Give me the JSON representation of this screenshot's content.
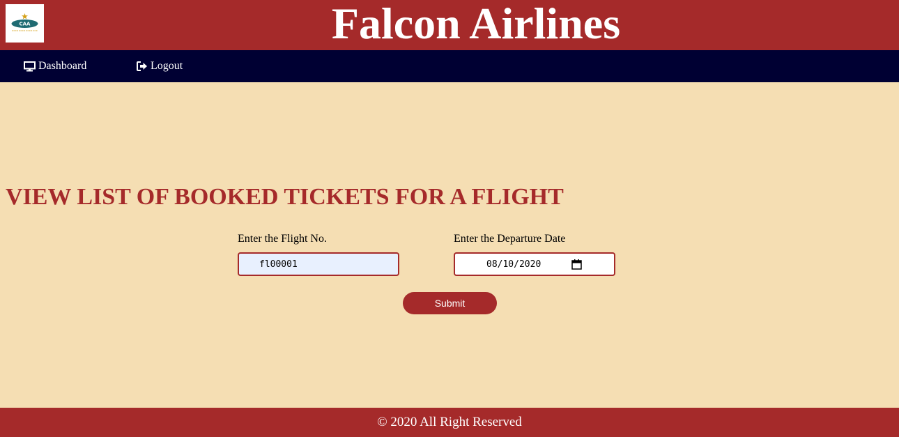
{
  "header": {
    "logo_text": "CAA",
    "logo_icon": "caa-airline-logo",
    "title": "Falcon Airlines"
  },
  "nav": {
    "items": [
      {
        "label": "Dashboard",
        "icon": "monitor-icon"
      },
      {
        "label": "Logout",
        "icon": "sign-out-icon"
      }
    ]
  },
  "main": {
    "heading": "VIEW LIST OF BOOKED TICKETS FOR A FLIGHT",
    "flight_field": {
      "label": "Enter the Flight No.",
      "value": "fl00001"
    },
    "date_field": {
      "label": "Enter the Departure Date",
      "value": "08/10/2020"
    },
    "submit_label": "Submit"
  },
  "footer": {
    "text": "© 2020 All Right Reserved"
  },
  "colors": {
    "header_bg": "#a52a2a",
    "nav_bg": "#000033",
    "page_bg": "#f5deb3",
    "accent": "#a52a2a",
    "autofill_bg": "#e8f0fe"
  }
}
